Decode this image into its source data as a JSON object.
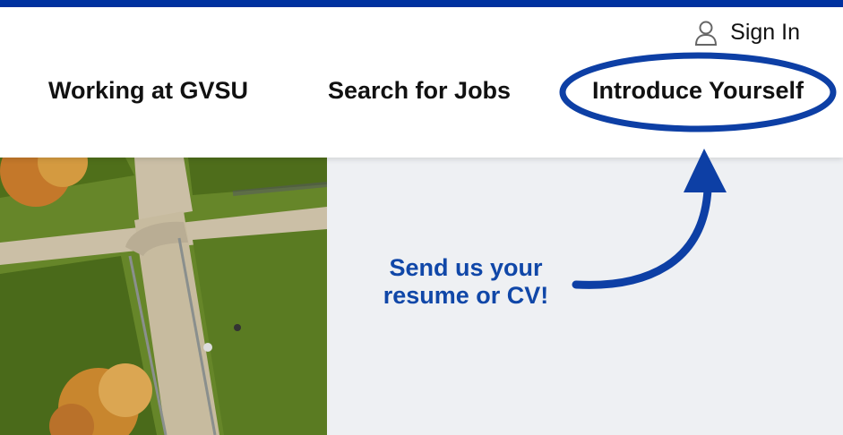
{
  "header": {
    "sign_in_label": "Sign In",
    "user_icon": "user-icon",
    "nav": [
      {
        "label": "Working at GVSU"
      },
      {
        "label": "Search for Jobs"
      },
      {
        "label": "Introduce Yourself",
        "highlighted": true
      }
    ]
  },
  "callout": {
    "line1": "Send us your",
    "line2": "resume or CV!",
    "arrow_icon": "curved-arrow-up-icon"
  },
  "colors": {
    "top_bar": "#0032a0",
    "accent": "#1047a8",
    "panel_background": "#eef0f3"
  }
}
